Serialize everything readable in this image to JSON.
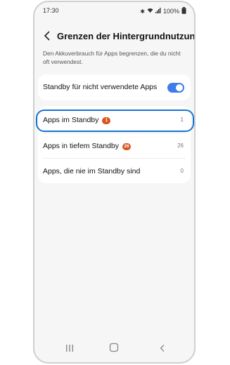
{
  "status_bar": {
    "time": "17:30",
    "battery": "100%",
    "icons": [
      "bluetooth-icon",
      "wifi-icon",
      "signal-icon",
      "battery-icon"
    ]
  },
  "header": {
    "title": "Grenzen der Hintergrundnutzung",
    "back_icon": "chevron-left-icon"
  },
  "description": "Den Akkuverbrauch für Apps begrenzen, die du nicht oft verwendest.",
  "toggle_item": {
    "label": "Standby für nicht verwendete Apps",
    "enabled": true
  },
  "list": [
    {
      "label": "Apps im Standby",
      "badge": "1",
      "count": "1"
    },
    {
      "label": "Apps in tiefem Standby",
      "badge": "26",
      "count": "26"
    },
    {
      "label": "Apps, die nie im Standby sind",
      "count": "0"
    }
  ],
  "navigation": {
    "recents": "recents-icon",
    "home": "home-icon",
    "back": "back-icon"
  },
  "colors": {
    "accent": "#3e7de9",
    "badge": "#d9541e",
    "highlight": "#1673d3"
  }
}
